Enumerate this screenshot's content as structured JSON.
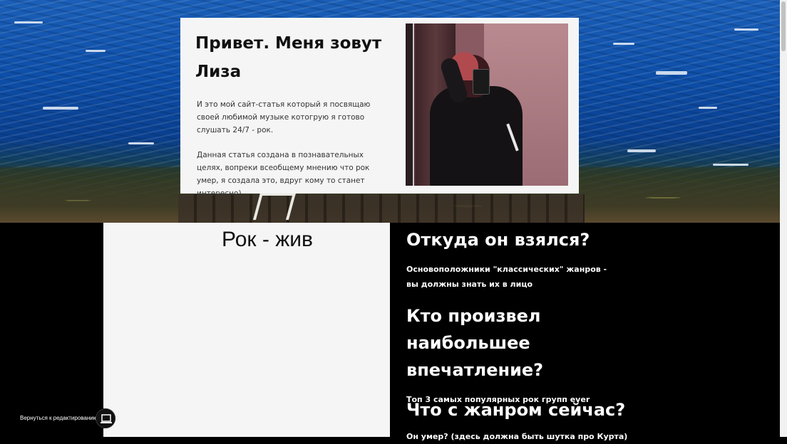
{
  "card": {
    "title": "Привет. Меня зовут Лиза",
    "paragraphs": [
      "И это мой сайт-статья который я посвящаю своей любимой музыке котогрую я готово слушать 24/7 - рок.",
      "Данная статья создана в познавательных целях, вопреки всеобщему мнению что рок умер, я создала это, вдруг кому то станет интересно)"
    ],
    "photo_icon": "selfie-photo"
  },
  "left_panel": {
    "heading": "Рок - жив"
  },
  "sections": [
    {
      "heading": "Откуда он взялся?",
      "subtitle": "Основоположники \"классических\" жанров - вы должны знать их в лицо"
    },
    {
      "heading": "Кто произвел наибольшее впечатление?",
      "subtitle": "Топ 3 самых популярных рок групп ever"
    },
    {
      "heading": "Что с жанром сейчас?",
      "subtitle": "Он умер? (здесь должна быть шутка про Курта)"
    }
  ],
  "edit_button": {
    "label": "Вернуться к редактированию",
    "icon": "laptop-icon"
  },
  "colors": {
    "card_bg": "#f5f5f5",
    "dark_bg": "#000000",
    "sea": "#0d4ea8"
  }
}
